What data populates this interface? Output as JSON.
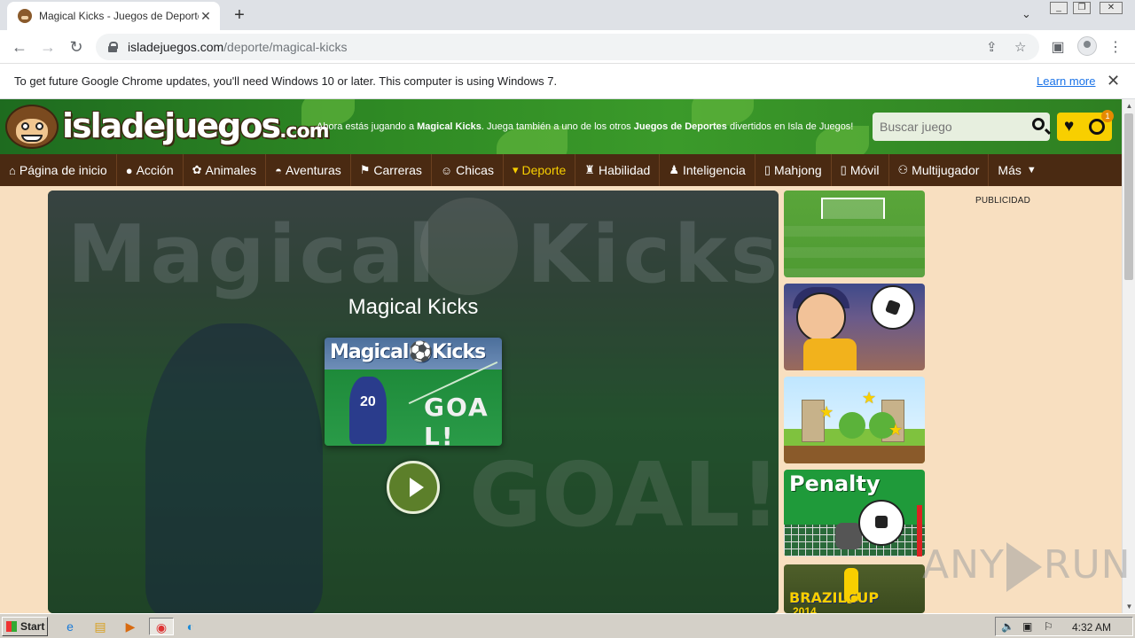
{
  "browser": {
    "tab_title": "Magical Kicks - Juegos de Deportes -",
    "tab_close": "✕",
    "new_tab": "+",
    "url_host": "isladejuegos.com",
    "url_path": "/deporte/magical-kicks"
  },
  "infobar": {
    "message": "To get future Google Chrome updates, you'll need Windows 10 or later. This computer is using Windows 7.",
    "learn_more": "Learn more",
    "close": "✕"
  },
  "site": {
    "logo_main": "isladejuegos",
    "logo_suffix": ".com",
    "tagline_pre": "Ahora estás jugando a ",
    "tagline_game": "Magical Kicks",
    "tagline_mid": ". Juega también a uno de los otros ",
    "tagline_cat": "Juegos de Deportes",
    "tagline_post": " divertidos en Isla de Juegos!",
    "search_placeholder": "Buscar juego",
    "history_badge": "1"
  },
  "nav": {
    "items": [
      {
        "label": "Página de inicio",
        "icon": "⌂"
      },
      {
        "label": "Acción",
        "icon": "●"
      },
      {
        "label": "Animales",
        "icon": "✿"
      },
      {
        "label": "Aventuras",
        "icon": "◓"
      },
      {
        "label": "Carreras",
        "icon": "⚑"
      },
      {
        "label": "Chicas",
        "icon": "☺"
      },
      {
        "label": "Deporte",
        "icon": "▾"
      },
      {
        "label": "Habilidad",
        "icon": "♜"
      },
      {
        "label": "Inteligencia",
        "icon": "♟"
      },
      {
        "label": "Mahjong",
        "icon": "▯"
      },
      {
        "label": "Móvil",
        "icon": "▯"
      },
      {
        "label": "Multijugador",
        "icon": "⚇"
      },
      {
        "label": "Más",
        "icon": "▼"
      }
    ],
    "active_index": 6
  },
  "game": {
    "title": "Magical Kicks",
    "bg_word_left": "Magical",
    "bg_word_right": "Kicks",
    "bg_goal": "GOAL!",
    "thumb_logo": "Magical⚽Kicks",
    "thumb_goal": "GOA L!",
    "thumb_number": "20"
  },
  "sidebar": {
    "penalty_label": "Penalty",
    "brazil_label": "BRAZILCUP",
    "brazil_year": "2014"
  },
  "ads": {
    "label": "PUBLICIDAD"
  },
  "watermark": {
    "left": "ANY",
    "right": "RUN"
  },
  "taskbar": {
    "start": "Start",
    "clock": "4:32 AM"
  },
  "colors": {
    "nav_bg": "#4a2a12",
    "nav_active": "#f8cf00",
    "page_bg": "#f8dfc0",
    "header_green": "#2f8a24",
    "play_button": "#5c7f2a"
  }
}
